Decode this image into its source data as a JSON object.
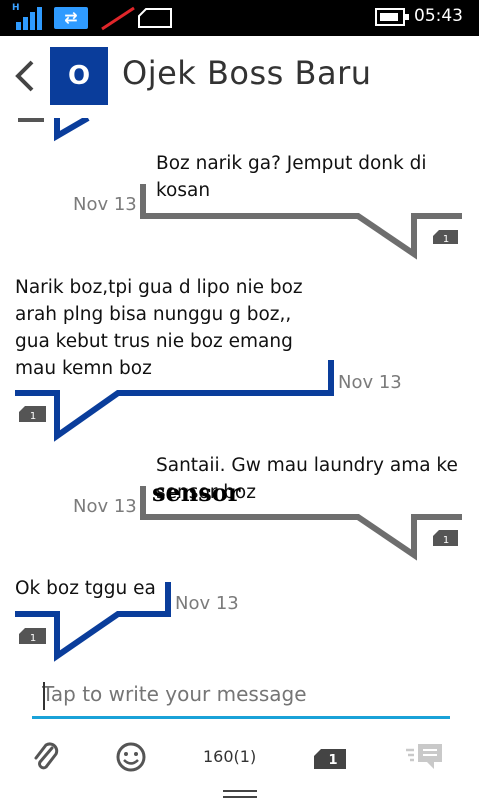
{
  "status_bar": {
    "network": "H",
    "time": "05:43"
  },
  "header": {
    "avatar_initial": "O",
    "title": "Ojek Boss Baru"
  },
  "messages": [
    {
      "direction": "outgoing",
      "text": "Boz narik ga? Jemput donk di kosan",
      "date": "Nov 13",
      "sim": "1"
    },
    {
      "direction": "incoming",
      "text": "Narik boz,tpi gua d lipo nie boz arah plng bisa nunggu g boz,, gua kebut trus nie boz emang mau kemn boz",
      "date": "Nov 13",
      "sim": "1"
    },
    {
      "direction": "outgoing",
      "text": "Santaii. Gw mau laundry ama ke sensor boz",
      "date": "Nov 13",
      "sim": "1",
      "overlay": "sensor"
    },
    {
      "direction": "incoming",
      "text": "Ok boz tggu ea",
      "date": "Nov 13",
      "sim": "1"
    }
  ],
  "composer": {
    "placeholder": "Tap to write your message"
  },
  "toolbar": {
    "char_counter": "160(1)",
    "sim_label": "1"
  },
  "colors": {
    "incoming": "#0a3d9b",
    "outgoing": "#6e6e6e",
    "accent": "#19a2d8"
  },
  "icons": [
    "back-icon",
    "attach-icon",
    "emoji-icon",
    "sim-icon",
    "send-icon"
  ]
}
